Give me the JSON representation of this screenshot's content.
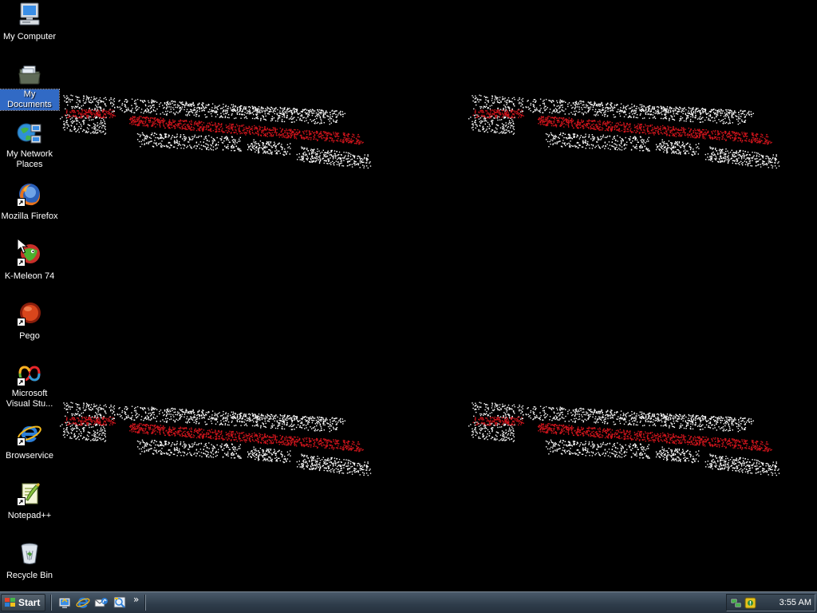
{
  "desktop": {
    "background_color": "#000000",
    "wallpaper": {
      "colors": [
        "#ffffff",
        "#d0141c"
      ]
    },
    "icons": [
      {
        "label": "My Computer",
        "icon": "computer-icon",
        "shortcut": false,
        "selected": false
      },
      {
        "label": "My Documents",
        "icon": "folder-documents-icon",
        "shortcut": false,
        "selected": true
      },
      {
        "label": "My Network Places",
        "icon": "network-places-icon",
        "shortcut": false,
        "selected": false
      },
      {
        "label": "Mozilla Firefox",
        "icon": "firefox-icon",
        "shortcut": true,
        "selected": false
      },
      {
        "label": "K-Meleon 74",
        "icon": "k-meleon-icon",
        "shortcut": true,
        "selected": false
      },
      {
        "label": "Pego",
        "icon": "pego-icon",
        "shortcut": true,
        "selected": false
      },
      {
        "label": "Microsoft Visual Stu...",
        "icon": "visual-studio-icon",
        "shortcut": true,
        "selected": false
      },
      {
        "label": "Browservice",
        "icon": "internet-explorer-icon",
        "shortcut": true,
        "selected": false
      },
      {
        "label": "Notepad++",
        "icon": "notepad-plus-plus-icon",
        "shortcut": true,
        "selected": false
      },
      {
        "label": "Recycle Bin",
        "icon": "recycle-bin-icon",
        "shortcut": false,
        "selected": false
      }
    ]
  },
  "taskbar": {
    "start_label": "Start",
    "quick_launch": [
      {
        "icon": "show-desktop-icon"
      },
      {
        "icon": "internet-explorer-icon"
      },
      {
        "icon": "outlook-express-icon"
      },
      {
        "icon": "windows-media-icon"
      }
    ],
    "quick_launch_more": "»",
    "tray": {
      "icons": [
        {
          "icon": "network-connection-icon"
        },
        {
          "icon": "security-alert-icon"
        }
      ],
      "clock": "3:55 AM"
    },
    "colors": {
      "bar": "#2e3c4a",
      "selection": "#316ac5"
    }
  }
}
